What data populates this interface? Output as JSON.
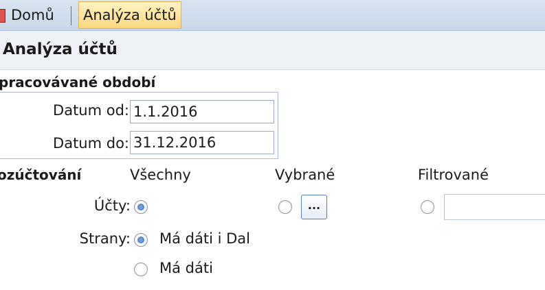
{
  "tabs": {
    "home_label": "Domů",
    "active_label": "Analýza účtů"
  },
  "page": {
    "title": "Analýza účtů"
  },
  "period": {
    "section_title": "pracovávané období",
    "from_label": "Datum od:",
    "from_value": "1.1.2016",
    "to_label": "Datum do:",
    "to_value": "31.12.2016"
  },
  "accounting": {
    "section_title": "ozúčtování",
    "columns": {
      "all": "Všechny",
      "selected": "Vybrané",
      "filtered": "Filtrované"
    },
    "accounts_label": "Účty:",
    "ellipsis_label": "...",
    "sides_label": "Strany:",
    "side_options": [
      "Má dáti i Dal",
      "Má dáti"
    ]
  },
  "colors": {
    "tab_active_bg": "#ffd87c",
    "tabbar_bg": "#c9d7e8",
    "accent": "#2f63a9"
  }
}
